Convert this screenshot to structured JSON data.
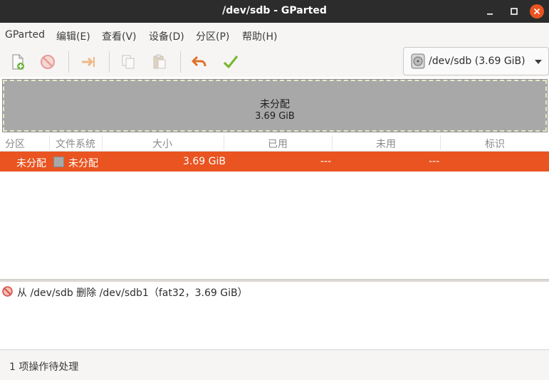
{
  "window": {
    "title": "/dev/sdb - GParted"
  },
  "menu": {
    "items": [
      {
        "label": "GParted"
      },
      {
        "label": "编辑(E)"
      },
      {
        "label": "查看(V)"
      },
      {
        "label": "设备(D)"
      },
      {
        "label": "分区(P)"
      },
      {
        "label": "帮助(H)"
      }
    ]
  },
  "toolbar": {
    "buttons": [
      {
        "icon": "new-partition-icon"
      },
      {
        "icon": "delete-icon"
      },
      {
        "icon": "resize-move-icon"
      },
      {
        "icon": "copy-icon"
      },
      {
        "icon": "paste-icon"
      },
      {
        "icon": "undo-icon"
      },
      {
        "icon": "apply-icon"
      }
    ],
    "device": "/dev/sdb (3.69 GiB)"
  },
  "visual": {
    "label": "未分配",
    "size": "3.69 GiB"
  },
  "table": {
    "columns": [
      "分区",
      "文件系统",
      "大小",
      "已用",
      "未用",
      "标识"
    ],
    "rows": [
      {
        "partition": "未分配",
        "filesystem": "未分配",
        "size": "3.69 GiB",
        "used": "---",
        "unused": "---",
        "flags": ""
      }
    ]
  },
  "operations": [
    {
      "text": "从 /dev/sdb 删除 /dev/sdb1（fat32，3.69 GiB）"
    }
  ],
  "status": {
    "text": "1 项操作待处理"
  },
  "colors": {
    "accent": "#e95420",
    "unallocated": "#a8a8a8",
    "titlebar": "#2c2c2c"
  }
}
